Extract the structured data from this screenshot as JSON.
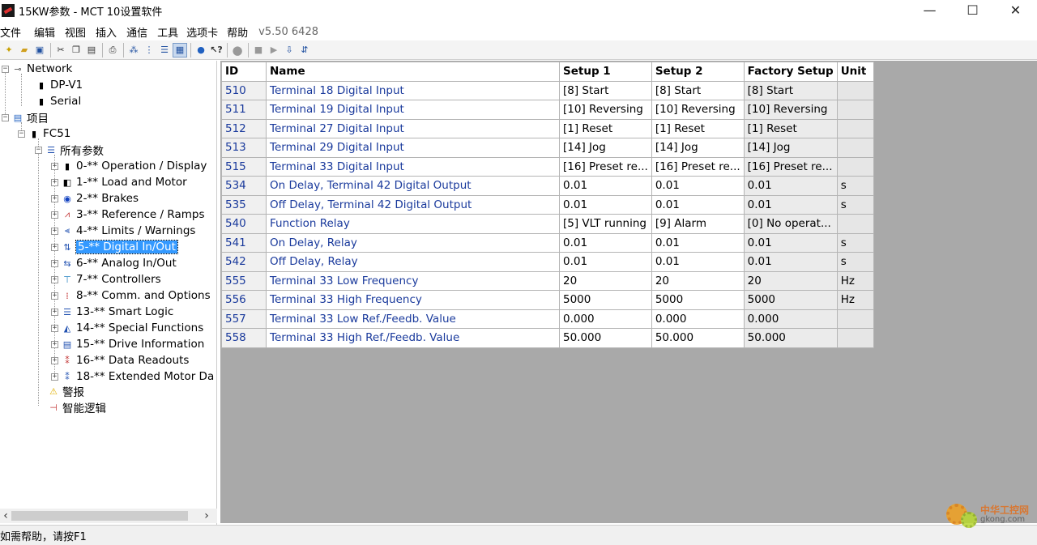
{
  "window": {
    "title": "15KW参数 - MCT 10设置软件",
    "controls": [
      "—",
      "☐",
      "✕"
    ]
  },
  "menu": {
    "items": [
      "文件",
      "编辑",
      "视图",
      "插入",
      "通信",
      "工具",
      "选项卡",
      "帮助"
    ],
    "version": "v5.50 6428"
  },
  "toolbar": {
    "buttons": [
      "new-icon",
      "open-icon",
      "save-icon",
      "cut-icon",
      "copy-icon",
      "paste-icon",
      "print-icon",
      "tree-view-icon",
      "list-view-icon",
      "details-view-icon",
      "grid-view-icon",
      "help-icon",
      "context-help-icon",
      "connect-icon",
      "stop-icon",
      "play-icon",
      "read-drive-icon",
      "write-drive-icon"
    ]
  },
  "tree": {
    "network": "Network",
    "dpv1": "DP-V1",
    "serial": "Serial",
    "project": "项目",
    "fc51": "FC51",
    "all_params": "所有参数",
    "groups": [
      "0-** Operation / Display",
      "1-** Load and Motor",
      "2-** Brakes",
      "3-** Reference / Ramps",
      "4-** Limits / Warnings",
      "5-** Digital In/Out",
      "6-** Analog In/Out",
      "7-** Controllers",
      "8-** Comm. and Options",
      "13-** Smart Logic",
      "14-** Special Functions",
      "15-** Drive Information",
      "16-** Data Readouts",
      "18-** Extended Motor Da"
    ],
    "alarm": "警报",
    "smart_logic": "智能逻辑",
    "selected_group": "5-** Digital In/Out"
  },
  "grid": {
    "columns": [
      "ID",
      "Name",
      "Setup 1",
      "Setup 2",
      "Factory Setup",
      "Unit"
    ],
    "rows": [
      [
        "510",
        "Terminal 18 Digital Input",
        "[8] Start",
        "[8] Start",
        "[8] Start",
        ""
      ],
      [
        "511",
        "Terminal 19 Digital Input",
        "[10] Reversing",
        "[10] Reversing",
        "[10] Reversing",
        ""
      ],
      [
        "512",
        "Terminal 27 Digital Input",
        "[1] Reset",
        "[1] Reset",
        "[1] Reset",
        ""
      ],
      [
        "513",
        "Terminal 29 Digital Input",
        "[14] Jog",
        "[14] Jog",
        "[14] Jog",
        ""
      ],
      [
        "515",
        "Terminal 33 Digital Input",
        "[16] Preset re...",
        "[16] Preset re...",
        "[16] Preset re...",
        ""
      ],
      [
        "534",
        "On Delay, Terminal 42 Digital Output",
        "0.01",
        "0.01",
        "0.01",
        "s"
      ],
      [
        "535",
        "Off Delay, Terminal 42 Digital Output",
        "0.01",
        "0.01",
        "0.01",
        "s"
      ],
      [
        "540",
        "Function Relay",
        "[5] VLT running",
        "[9] Alarm",
        "[0] No operat...",
        ""
      ],
      [
        "541",
        "On Delay, Relay",
        "0.01",
        "0.01",
        "0.01",
        "s"
      ],
      [
        "542",
        "Off Delay, Relay",
        "0.01",
        "0.01",
        "0.01",
        "s"
      ],
      [
        "555",
        "Terminal 33 Low Frequency",
        "20",
        "20",
        "20",
        "Hz"
      ],
      [
        "556",
        "Terminal 33 High Frequency",
        "5000",
        "5000",
        "5000",
        "Hz"
      ],
      [
        "557",
        "Terminal 33 Low Ref./Feedb. Value",
        "0.000",
        "0.000",
        "0.000",
        ""
      ],
      [
        "558",
        "Terminal 33 High Ref./Feedb. Value",
        "50.000",
        "50.000",
        "50.000",
        ""
      ]
    ]
  },
  "status": {
    "text": "如需帮助，请按F1"
  },
  "watermark": {
    "cn": "中华工控网",
    "url": "gkong.com"
  },
  "colors": {
    "selection": "#3399ff",
    "link_text": "#1a3a9c",
    "grid_background": "#a9a9a9"
  }
}
